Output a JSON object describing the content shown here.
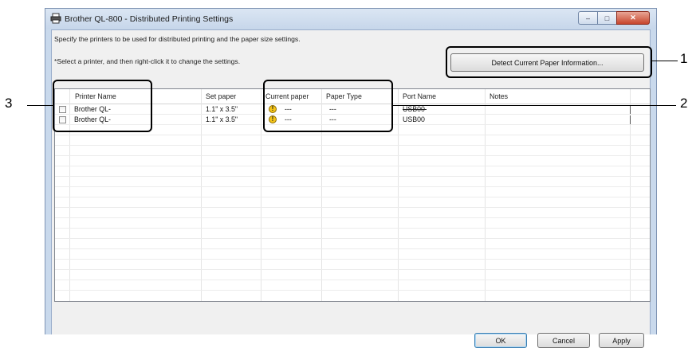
{
  "window": {
    "title": "Brother QL-800 - Distributed Printing Settings",
    "controls": {
      "minimize": "–",
      "maximize": "□",
      "close": "✕"
    }
  },
  "instructions": {
    "line1": "Specify the printers to be used for distributed printing and the paper size settings.",
    "line2": "*Select a printer, and then right-click it to change the settings."
  },
  "detect_button": "Detect Current Paper Information...",
  "table": {
    "columns": [
      "Printer Name",
      "Set paper",
      "Current paper",
      "Paper Type",
      "Port Name",
      "Notes"
    ],
    "rows": [
      {
        "checked": false,
        "printer_name": "Brother QL-",
        "set_paper": "1.1\" x 3.5\"",
        "current_paper": "---",
        "paper_type": "---",
        "port_name": "USB00",
        "warning_icon": "exclamation-icon"
      },
      {
        "checked": false,
        "printer_name": "Brother QL-",
        "set_paper": "1.1\" x 3.5\"",
        "current_paper": "---",
        "paper_type": "---",
        "port_name": "USB00",
        "warning_icon": "exclamation-icon"
      }
    ]
  },
  "buttons": {
    "ok": "OK",
    "cancel": "Cancel",
    "apply": "Apply"
  },
  "callouts": {
    "c1": "1",
    "c2": "2",
    "c3": "3"
  },
  "colors": {
    "title_bar": "#c9d9ec",
    "close_button": "#c7452d",
    "warning": "#f4c419"
  }
}
